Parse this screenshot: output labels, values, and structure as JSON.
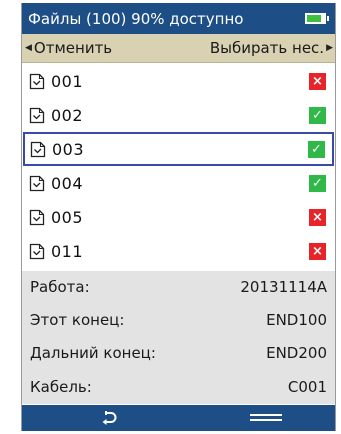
{
  "header": {
    "title": "Файлы (100) 90% доступно",
    "battery_icon": "battery-icon",
    "battery_level": 0.8
  },
  "softkeys": {
    "left_label": "Отменить",
    "right_label": "Выбирать нес."
  },
  "files": [
    {
      "name": "001",
      "status": "fail"
    },
    {
      "name": "002",
      "status": "pass"
    },
    {
      "name": "003",
      "status": "pass",
      "selected": true
    },
    {
      "name": "004",
      "status": "pass"
    },
    {
      "name": "005",
      "status": "fail"
    },
    {
      "name": "011",
      "status": "fail"
    }
  ],
  "status_icons": {
    "fail": "×",
    "pass": "✓"
  },
  "info": {
    "job_label": "Работа:",
    "job_value": "20131114A",
    "this_end_label": "Этот конец:",
    "this_end_value": "END100",
    "far_end_label": "Дальний конец:",
    "far_end_value": "END200",
    "cable_label": "Кабель:",
    "cable_value": "C001"
  },
  "colors": {
    "title_bar": "#1d4f86",
    "softkey_bar": "#d8d1b2",
    "pass": "#30b848",
    "fail": "#e8242b",
    "selection": "#3a4aa8",
    "info_panel": "#e3e3e3"
  },
  "bottom_bar": {
    "back_icon": "back-arrow-icon",
    "menu_icon": "menu-icon"
  }
}
